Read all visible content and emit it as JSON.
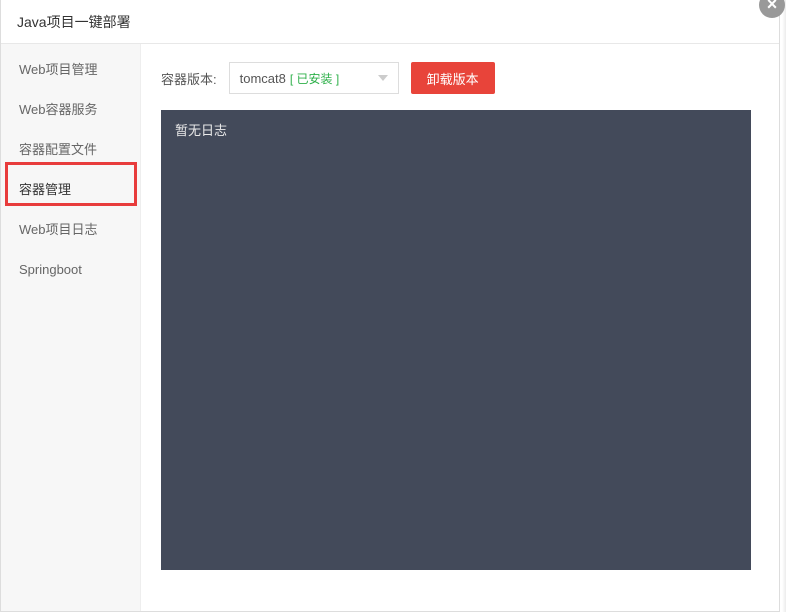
{
  "modal": {
    "title": "Java项目一键部署"
  },
  "sidebar": {
    "items": [
      {
        "label": "Web项目管理"
      },
      {
        "label": "Web容器服务"
      },
      {
        "label": "容器配置文件"
      },
      {
        "label": "容器管理"
      },
      {
        "label": "Web项目日志"
      },
      {
        "label": "Springboot"
      }
    ]
  },
  "toolbar": {
    "version_label": "容器版本:",
    "select_value": "tomcat8",
    "installed_tag": "[ 已安装 ]",
    "uninstall_label": "卸载版本"
  },
  "log": {
    "empty_text": "暂无日志"
  }
}
